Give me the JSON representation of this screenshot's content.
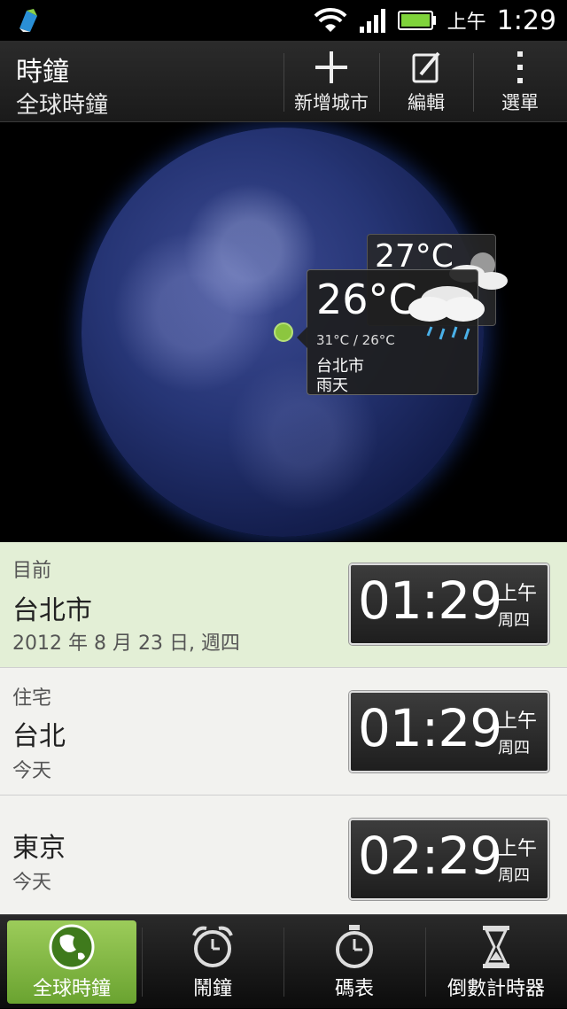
{
  "status_bar": {
    "ampm": "上午",
    "time": "1:29"
  },
  "action_bar": {
    "title": "時鐘",
    "subtitle": "全球時鐘",
    "add_city_label": "新增城市",
    "edit_label": "編輯",
    "menu_label": "選單"
  },
  "globe": {
    "back_card": {
      "temp": "27°C"
    },
    "weather_card": {
      "temp": "26°C",
      "range": "31°C / 26°C",
      "city": "台北市",
      "condition": "雨天"
    }
  },
  "clocks": [
    {
      "label": "目前",
      "city": "台北市",
      "sub": "2012 年 8 月 23 日, 週四",
      "time": "01:29",
      "ampm": "上午",
      "weekday": "周四"
    },
    {
      "label": "住宅",
      "city": "台北",
      "sub": "今天",
      "time": "01:29",
      "ampm": "上午",
      "weekday": "周四"
    },
    {
      "label": "",
      "city": "東京",
      "sub": "今天",
      "time": "02:29",
      "ampm": "上午",
      "weekday": "周四"
    }
  ],
  "bottom_nav": [
    {
      "label": "全球時鐘",
      "icon": "globe-icon"
    },
    {
      "label": "鬧鐘",
      "icon": "alarm-clock-icon"
    },
    {
      "label": "碼表",
      "icon": "stopwatch-icon"
    },
    {
      "label": "倒數計時器",
      "icon": "hourglass-icon"
    }
  ],
  "colors": {
    "accent": "#8cc63f",
    "current_row": "#e3efd6"
  }
}
